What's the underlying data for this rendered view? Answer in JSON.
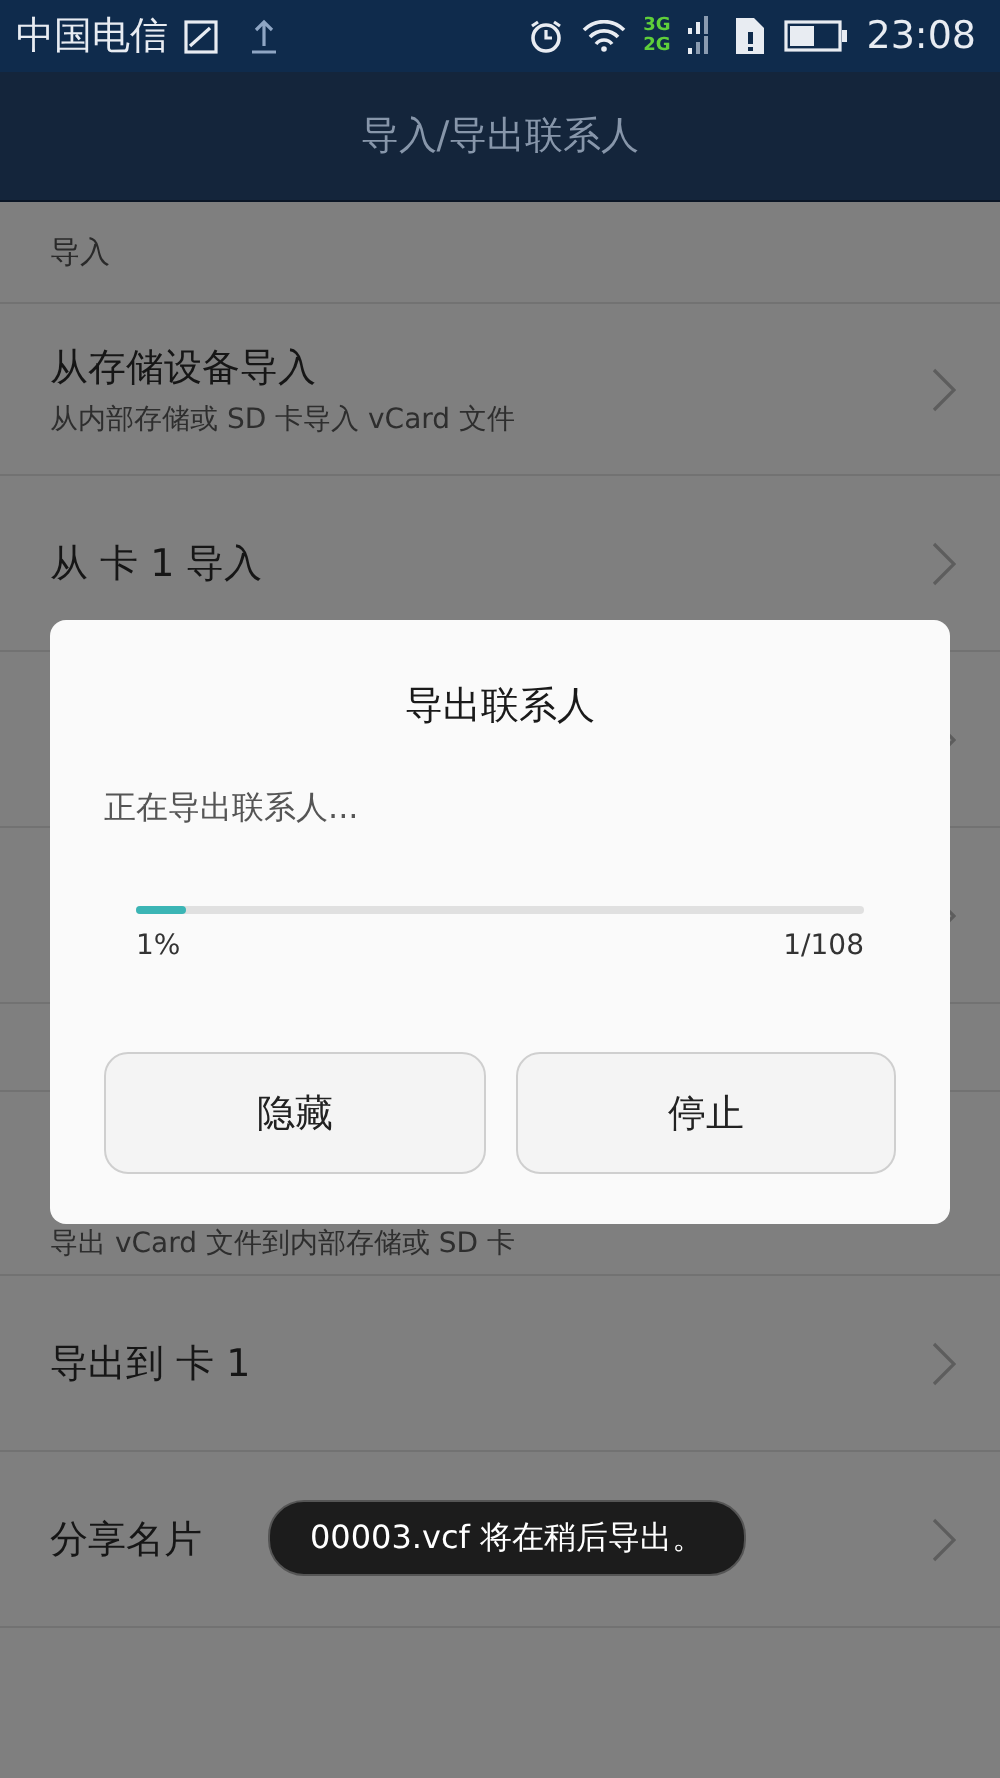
{
  "status_bar": {
    "carrier": "中国电信",
    "network_top": "3G",
    "network_bottom": "2G",
    "time": "23:08"
  },
  "header": {
    "title": "导入/导出联系人"
  },
  "import_section": {
    "heading": "导入",
    "rows": [
      {
        "title": "从存储设备导入",
        "subtitle": "从内部存储或 SD 卡导入 vCard 文件"
      },
      {
        "title": "从 卡 1 导入"
      }
    ]
  },
  "export_section": {
    "partial_subtitle": "导出 vCard 文件到内部存储或 SD 卡",
    "rows": [
      {
        "title": "导出到 卡 1"
      },
      {
        "title": "分享名片"
      }
    ]
  },
  "dialog": {
    "title": "导出联系人",
    "message": "正在导出联系人...",
    "level": 0.07,
    "percent": "1%",
    "count": "1/108",
    "buttons": [
      "隐藏",
      "停止"
    ]
  },
  "toast": "00003.vcf 将在稍后导出。"
}
